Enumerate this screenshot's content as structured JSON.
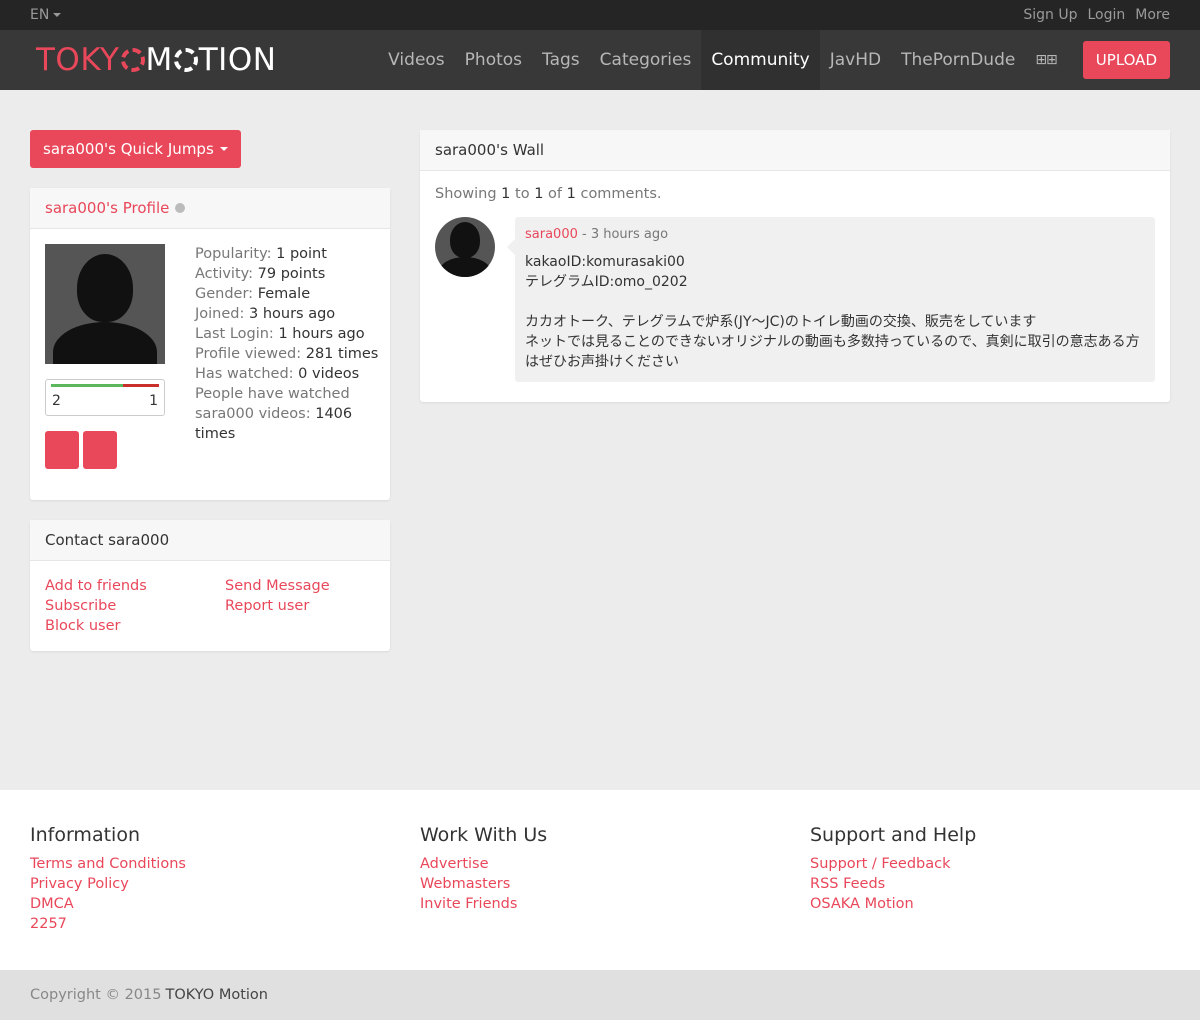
{
  "topbar": {
    "language": "EN",
    "links": [
      "Sign Up",
      "Login",
      "More"
    ]
  },
  "brand": {
    "logo_part1": "TOKY",
    "logo_part2": "M",
    "logo_part3": "TION"
  },
  "nav": {
    "items": [
      "Videos",
      "Photos",
      "Tags",
      "Categories",
      "Community",
      "JavHD",
      "ThePornDude"
    ],
    "active": "Community",
    "grid_icon": "grid-icon",
    "upload_label": "UPLOAD"
  },
  "quick_jumps": {
    "label": "sara000's Quick Jumps"
  },
  "profile": {
    "heading": "sara000's Profile",
    "status_icon": "offline-dot",
    "stats": [
      {
        "label": "Popularity:",
        "value": "1 point"
      },
      {
        "label": "Activity:",
        "value": "79 points"
      },
      {
        "label": "Gender:",
        "value": "Female"
      },
      {
        "label": "Joined:",
        "value": "3 hours ago"
      },
      {
        "label": "Last Login:",
        "value": "1 hours ago"
      },
      {
        "label": "Profile viewed:",
        "value": "281 times"
      },
      {
        "label": "Has watched:",
        "value": "0 videos"
      },
      {
        "label": "People have watched",
        "value": ""
      },
      {
        "label": "sara000 videos:",
        "value": "1406 times"
      }
    ],
    "votes": {
      "up_icon": "",
      "up": "2",
      "down_icon": "",
      "down": "1",
      "up_ratio": 0.67
    },
    "action_icons": [
      "",
      ""
    ]
  },
  "contact": {
    "heading": "Contact sara000",
    "links": [
      "Add to friends",
      "Send Message",
      "Subscribe",
      "Report user",
      "Block user"
    ]
  },
  "wall": {
    "heading": "sara000's Wall",
    "showing_prefix": "Showing",
    "from": "1",
    "to_word": "to",
    "to": "1",
    "of_word": "of",
    "total": "1",
    "suffix": "comments.",
    "comments": [
      {
        "author": "sara000",
        "time": " - 3 hours ago",
        "text": "kakaoID:komurasaki00\nテレグラムID:omo_0202\n\nカカオトーク、テレグラムで炉系(JY〜JC)のトイレ動画の交換、販売をしています\nネットでは見ることのできないオリジナルの動画も多数持っているので、真剣に取引の意志ある方はぜひお声掛けください"
      }
    ]
  },
  "footer": {
    "columns": [
      {
        "title": "Information",
        "links": [
          "Terms and Conditions",
          "Privacy Policy",
          "DMCA",
          "2257"
        ]
      },
      {
        "title": "Work With Us",
        "links": [
          "Advertise",
          "Webmasters",
          "Invite Friends"
        ]
      },
      {
        "title": "Support and Help",
        "links": [
          "Support / Feedback",
          "RSS Feeds",
          "OSAKA Motion"
        ]
      }
    ],
    "copyright_prefix": "Copyright © 2015",
    "copyright_brand": "TOKYO Motion"
  },
  "colors": {
    "accent": "#e9475a",
    "topbar": "#252525",
    "navbar": "#383838"
  }
}
